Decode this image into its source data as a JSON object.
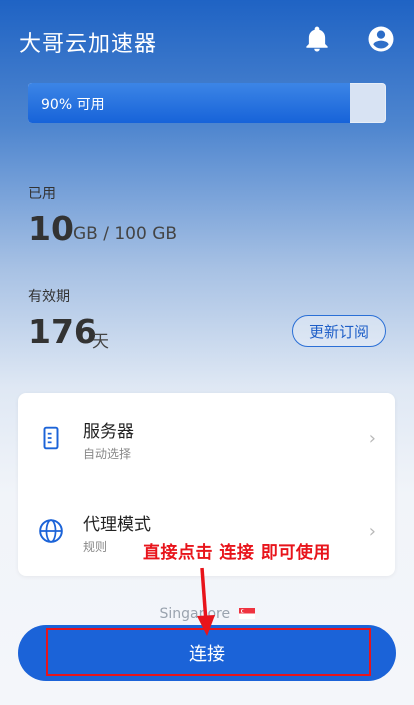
{
  "header": {
    "title": "大哥云加速器",
    "bell_icon": "bell-icon",
    "account_icon": "account-circle-icon"
  },
  "quota": {
    "label": "90% 可用",
    "available_fraction": 0.9
  },
  "used": {
    "label": "已用",
    "value": "10",
    "unit": "GB / 100 GB"
  },
  "validity": {
    "label": "有效期",
    "value": "176",
    "unit": "天",
    "renew_label": "更新订阅"
  },
  "menu": {
    "server": {
      "title": "服务器",
      "subtitle": "自动选择"
    },
    "proxy": {
      "title": "代理模式",
      "subtitle": "规则"
    }
  },
  "annotation": "直接点击 连接 即可使用",
  "location": "Singapore",
  "connect_label": "连接",
  "colors": {
    "accent": "#1b63d8",
    "annotation_red": "#e8141b"
  }
}
